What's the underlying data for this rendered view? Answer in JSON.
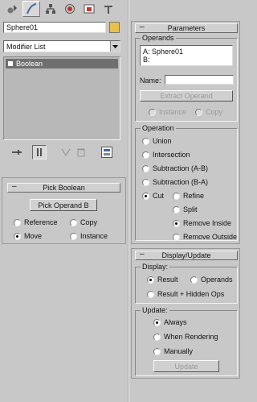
{
  "tabs": [
    {
      "name": "create-icon"
    },
    {
      "name": "modify-icon",
      "active": true
    },
    {
      "name": "hierarchy-icon"
    },
    {
      "name": "motion-icon"
    },
    {
      "name": "display-icon"
    },
    {
      "name": "utilities-icon"
    }
  ],
  "object_name": "Sphere01",
  "object_color": "#e8c04a",
  "modifier_list": "Modifier List",
  "stack_items": [
    "Boolean"
  ],
  "pick_boolean": {
    "title": "Pick Boolean",
    "pick_button": "Pick Operand B",
    "reference": "Reference",
    "copy": "Copy",
    "move": "Move",
    "instance": "Instance"
  },
  "parameters": {
    "title": "Parameters",
    "operands_label": "Operands",
    "operands": [
      "A: Sphere01",
      "B:"
    ],
    "name_label": "Name:",
    "name_value": "",
    "extract_button": "Extract Operand",
    "instance": "Instance",
    "copy": "Copy",
    "operation_label": "Operation",
    "union": "Union",
    "intersection": "Intersection",
    "subtraction_ab": "Subtraction (A-B)",
    "subtraction_ba": "Subtraction (B-A)",
    "cut": "Cut",
    "refine": "Refine",
    "split": "Split",
    "remove_inside": "Remove Inside",
    "remove_outside": "Remove Outside"
  },
  "display_update": {
    "title": "Display/Update",
    "display_label": "Display:",
    "result": "Result",
    "operands": "Operands",
    "result_hidden": "Result + Hidden Ops",
    "update_label": "Update:",
    "always": "Always",
    "when_rendering": "When Rendering",
    "manually": "Manually",
    "update_button": "Update"
  }
}
